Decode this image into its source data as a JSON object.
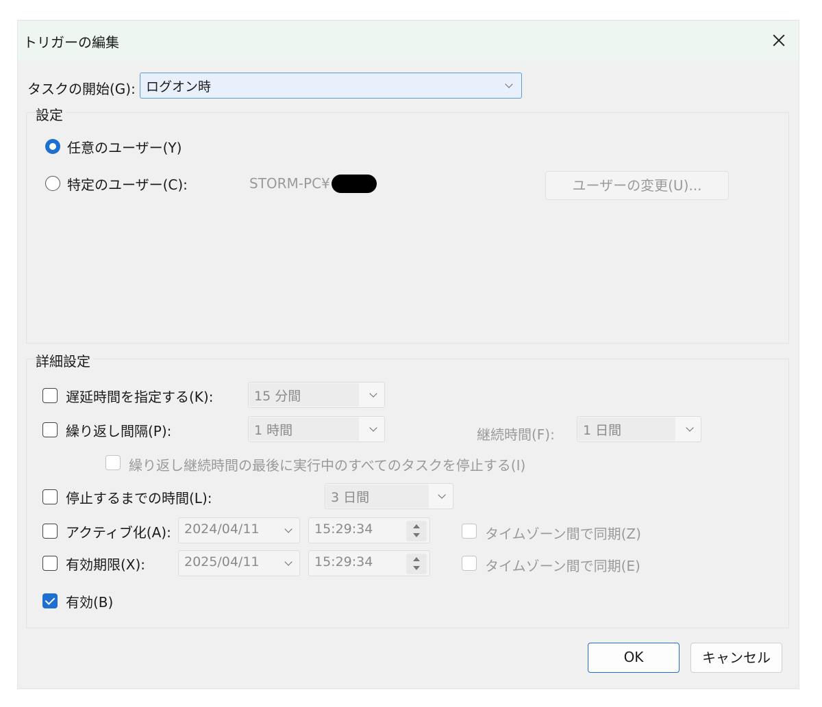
{
  "dialog": {
    "title": "トリガーの編集"
  },
  "task_start": {
    "label": "タスクの開始(G):",
    "value": "ログオン時"
  },
  "settings": {
    "label": "設定",
    "any_user": "任意のユーザー(Y)",
    "specific_user": "特定のユーザー(C):",
    "user_name": "STORM-PC¥",
    "change_user_button": "ユーザーの変更(U)..."
  },
  "advanced": {
    "label": "詳細設定",
    "delay": {
      "label": "遅延時間を指定する(K):",
      "value": "15 分間"
    },
    "repeat": {
      "label": "繰り返し間隔(P):",
      "value": "1 時間"
    },
    "duration": {
      "label": "継続時間(F):",
      "value": "1 日間"
    },
    "stop_all": {
      "label": "繰り返し継続時間の最後に実行中のすべてのタスクを停止する(I)"
    },
    "stop_after": {
      "label": "停止するまでの時間(L):",
      "value": "3 日間"
    },
    "activate": {
      "label": "アクティブ化(A):",
      "date": "2024/04/11",
      "time": "15:29:34",
      "sync": "タイムゾーン間で同期(Z)"
    },
    "expire": {
      "label": "有効期限(X):",
      "date": "2025/04/11",
      "time": "15:29:34",
      "sync": "タイムゾーン間で同期(E)"
    },
    "enabled": {
      "label": "有効(B)"
    }
  },
  "buttons": {
    "ok": "OK",
    "cancel": "キャンセル"
  }
}
